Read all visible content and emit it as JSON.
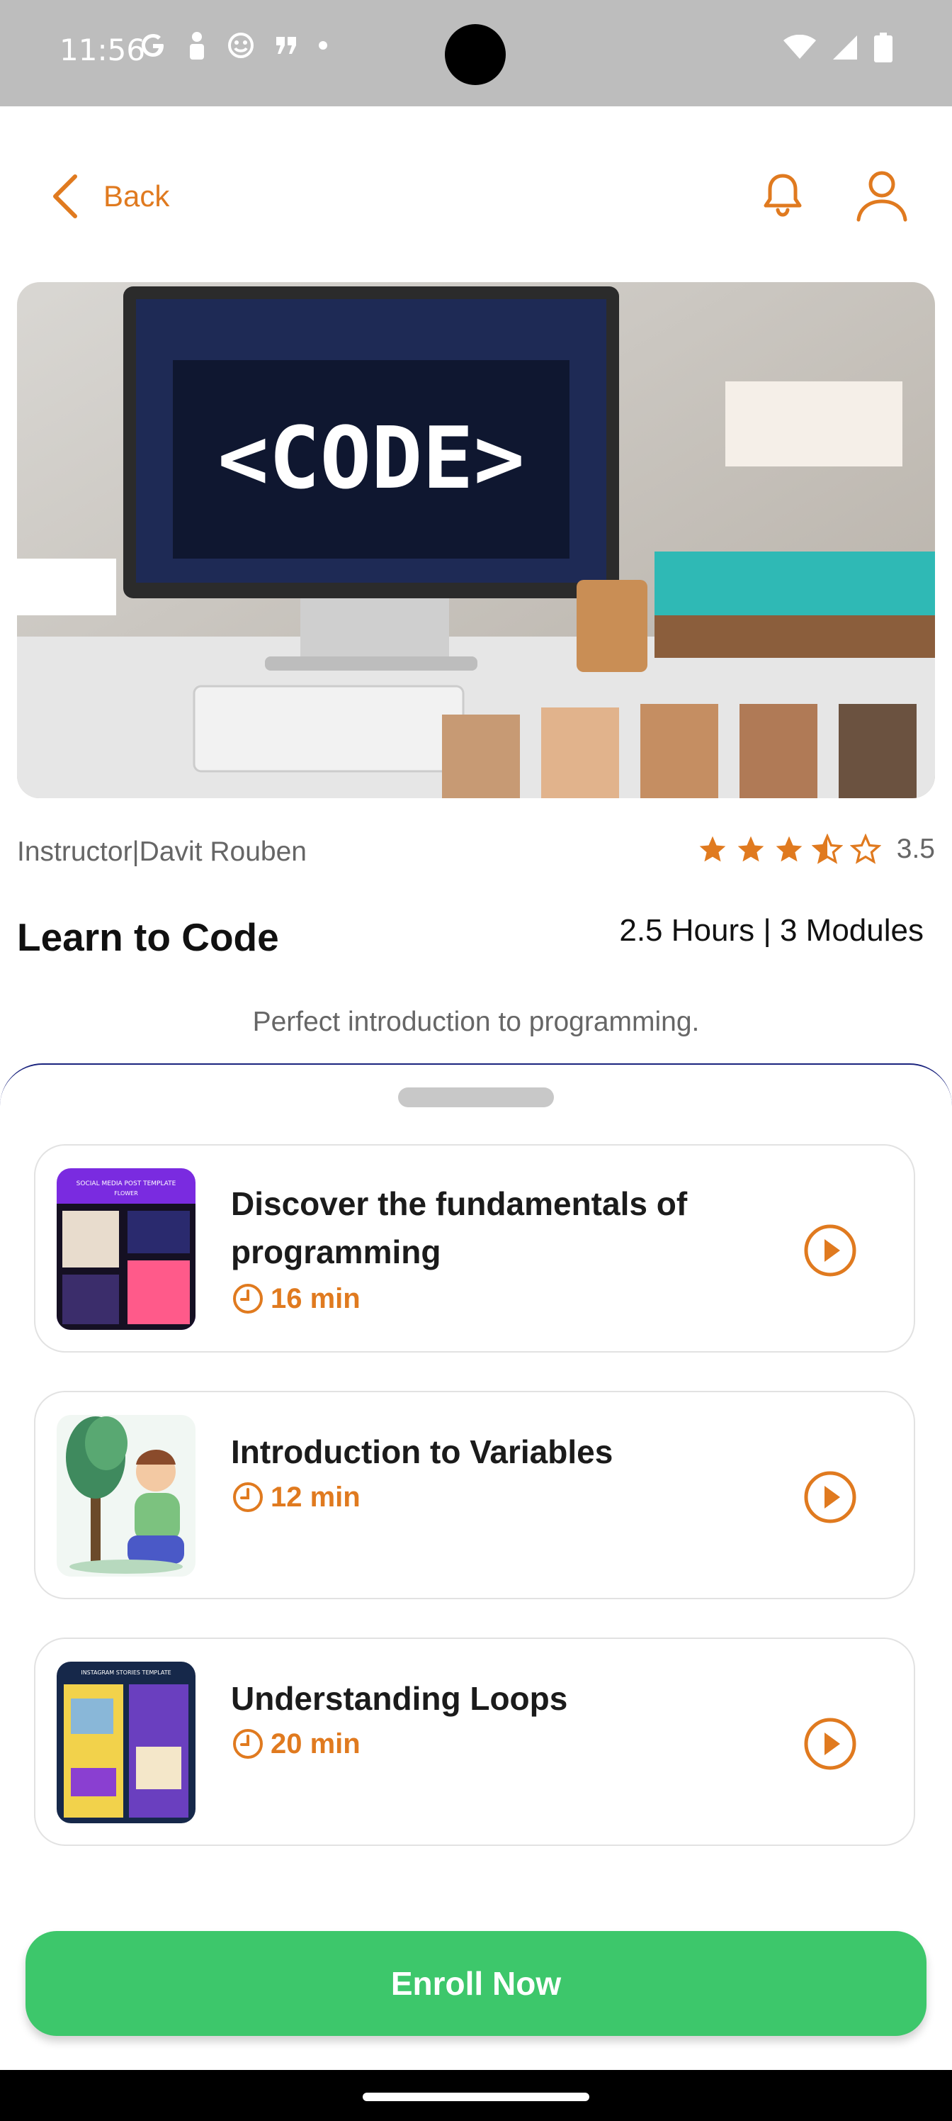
{
  "status_bar": {
    "time": "11:56",
    "left_icons": [
      "google-icon",
      "person-icon",
      "smiley-icon",
      "quote-icon",
      "dot-icon"
    ],
    "right_icons": [
      "wifi-icon",
      "signal-icon",
      "battery-icon"
    ]
  },
  "header": {
    "back_label": "Back",
    "icons": [
      "bell-icon",
      "user-icon"
    ]
  },
  "hero": {
    "image_text": "<CODE>"
  },
  "course": {
    "instructor": "Instructor|Davit Rouben",
    "rating_value": "3.5",
    "rating": 3.5,
    "rating_max": 5,
    "title": "Learn to Code",
    "duration": "2.5 Hours | 3 Modules",
    "tagline": "Perfect introduction to programming."
  },
  "lessons": [
    {
      "title": "Discover the fundamentals of programming",
      "time": "16 min",
      "thumb_text_1": "SOCIAL MEDIA POST TEMPLATE",
      "thumb_text_2": "FLOWER"
    },
    {
      "title": "Introduction to Variables",
      "time": "12 min"
    },
    {
      "title": "Understanding Loops",
      "time": "20 min",
      "thumb_text_1": "INSTAGRAM STORIES TEMPLATE"
    }
  ],
  "enroll_label": "Enroll Now",
  "colors": {
    "accent": "#e07a1f",
    "enroll": "#3dc76b"
  }
}
